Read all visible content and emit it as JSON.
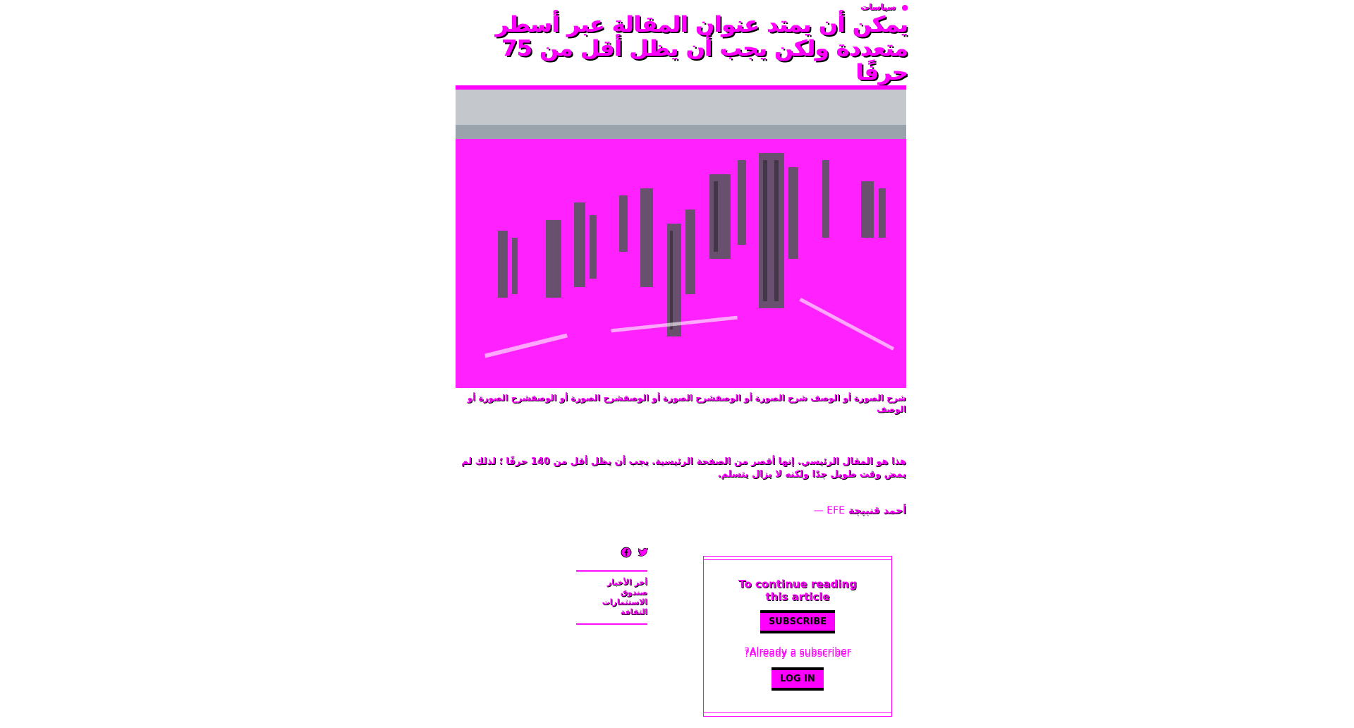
{
  "article": {
    "section": "سياسات",
    "headline": "يمكن أن يمتد عنوان المقالة عبر أسطر متعددة ولكن يجب أن يظل أقل من 75 حرفًا",
    "caption": "شرح الصورة أو الوصف شرح الصورة أو الوصفشرح الصورة أو الوصفشرح الصورة أو الوصفشرح الصورة أو الوصف",
    "lead": "هذا هو المقال الرئيسي. إنها أقصر من الصفحة الرئيسية. يجب أن يظل أقل من 140 حرفًا ؛ لذلك لم يمض وقت طويل جدًا ولكنه لا يزال يتسلم.",
    "author": "أحمد قنبيجة",
    "agency": "EFE —"
  },
  "sidebar": {
    "links": [
      "أخر الأخبار",
      "صندوق الاستثمارات",
      "الثقافة"
    ]
  },
  "paywall": {
    "heading": "To continue reading this article",
    "subscribe_label": "SUBSCRIBE",
    "already_label": "?Already a subscriber",
    "login_label": "LOG IN"
  },
  "icons": {
    "section": "lock-icon",
    "social": [
      "twitter-icon",
      "facebook-icon"
    ]
  },
  "colors": {
    "accent": "#ff00ff",
    "text_shadow": "#000000",
    "background": "#ffffff"
  }
}
